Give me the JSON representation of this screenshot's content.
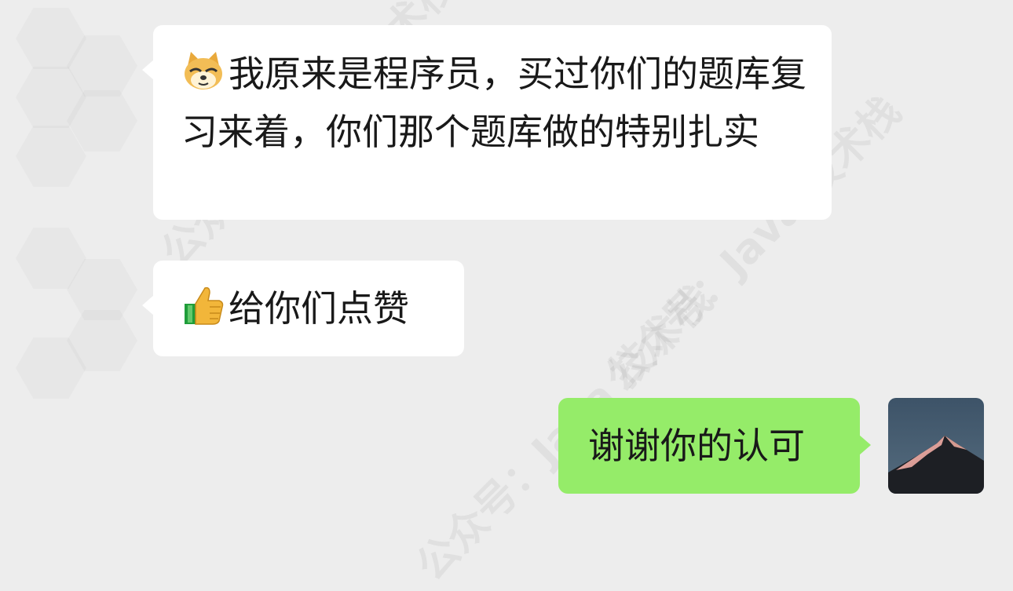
{
  "messages": [
    {
      "sender": "other",
      "emoji": "doge-face-icon",
      "text": "我原来是程序员，买过你们的题库复习来着，你们那个题库做的特别扎实"
    },
    {
      "sender": "other",
      "emoji": "thumbs-up-icon",
      "text": "给你们点赞"
    },
    {
      "sender": "self",
      "emoji": null,
      "text": "谢谢你的认可"
    }
  ],
  "watermark": "公众号：Java 技术栈",
  "colors": {
    "background": "#ededed",
    "incoming_bubble": "#ffffff",
    "outgoing_bubble": "#95ec69",
    "text": "#191919"
  }
}
